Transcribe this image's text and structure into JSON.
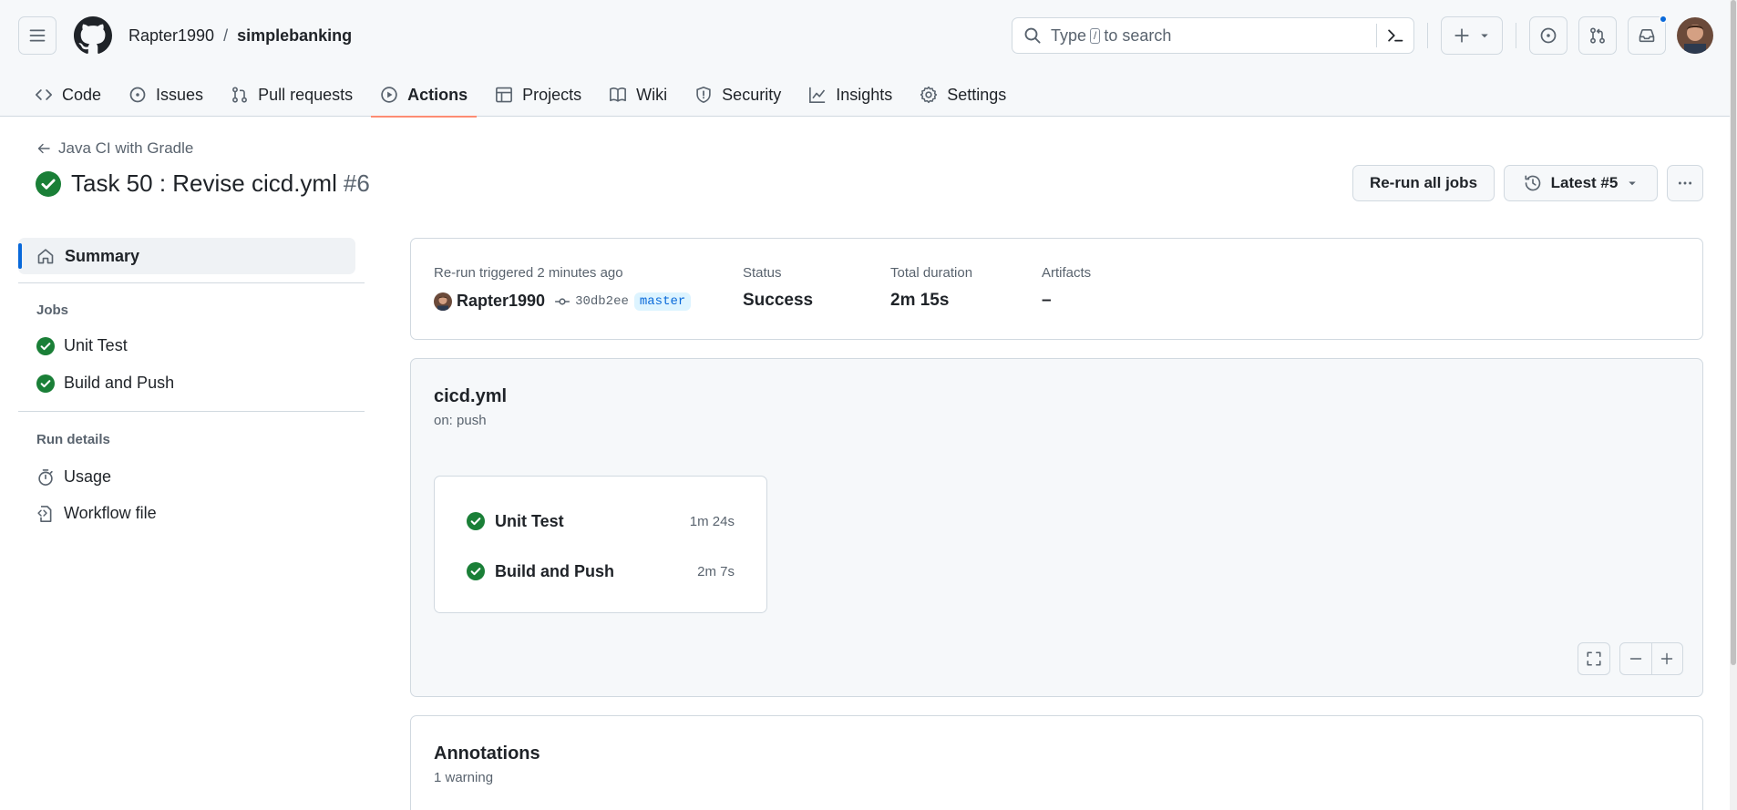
{
  "repo": {
    "owner": "Rapter1990",
    "separator": "/",
    "name": "simplebanking"
  },
  "search": {
    "prefix": "Type",
    "key": "/",
    "suffix": "to search"
  },
  "tabs": [
    {
      "label": "Code",
      "icon": "code-icon"
    },
    {
      "label": "Issues",
      "icon": "issue-icon"
    },
    {
      "label": "Pull requests",
      "icon": "pull-request-icon"
    },
    {
      "label": "Actions",
      "icon": "play-icon",
      "active": true
    },
    {
      "label": "Projects",
      "icon": "table-icon"
    },
    {
      "label": "Wiki",
      "icon": "book-icon"
    },
    {
      "label": "Security",
      "icon": "shield-icon"
    },
    {
      "label": "Insights",
      "icon": "graph-icon"
    },
    {
      "label": "Settings",
      "icon": "gear-icon"
    }
  ],
  "run": {
    "workflow_back": "Java CI with Gradle",
    "title": "Task 50 : Revise cicd.yml",
    "number": "#6",
    "rerun_label": "Re-run all jobs",
    "latest_label": "Latest #5"
  },
  "sidebar": {
    "summary": "Summary",
    "jobs_heading": "Jobs",
    "jobs": [
      "Unit Test",
      "Build and Push"
    ],
    "details_heading": "Run details",
    "details": [
      "Usage",
      "Workflow file"
    ]
  },
  "info": {
    "trigger_text": "Re-run triggered 2 minutes ago",
    "user": "Rapter1990",
    "commit": "30db2ee",
    "branch": "master",
    "status_label": "Status",
    "status_value": "Success",
    "duration_label": "Total duration",
    "duration_value": "2m 15s",
    "artifacts_label": "Artifacts",
    "artifacts_value": "–"
  },
  "graph": {
    "file": "cicd.yml",
    "trigger": "on: push",
    "jobs": [
      {
        "name": "Unit Test",
        "duration": "1m 24s"
      },
      {
        "name": "Build and Push",
        "duration": "2m 7s"
      }
    ]
  },
  "annotations": {
    "title": "Annotations",
    "count": "1 warning"
  },
  "colors": {
    "success": "#1a7f37",
    "accent": "#0969da",
    "tab_underline": "#fd8c73"
  }
}
